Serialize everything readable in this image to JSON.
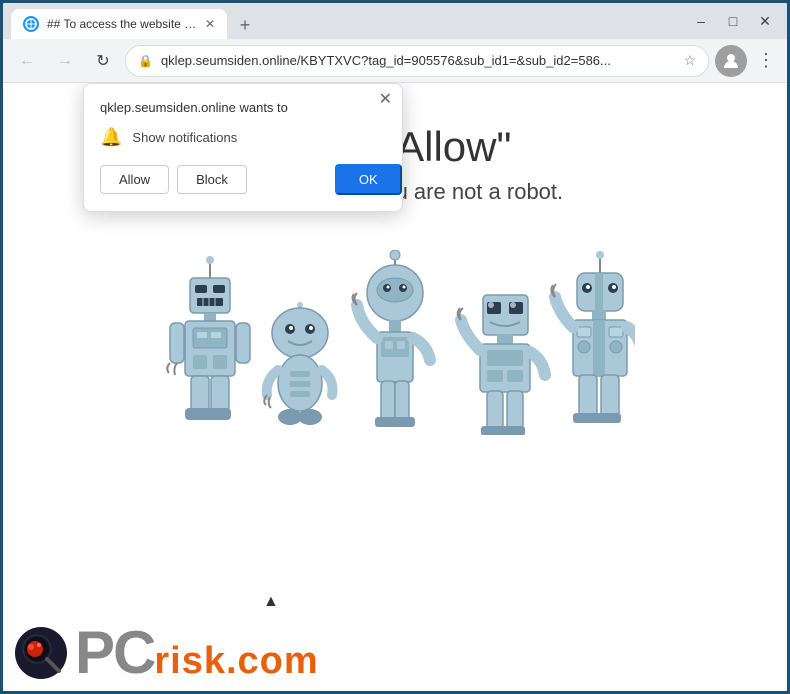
{
  "browser": {
    "tab": {
      "title": "## To access the website click th...",
      "favicon": "🌐"
    },
    "address": {
      "url": "qklep.seumsiden.online/KBYTXVC?tag_id=905576&sub_id1=&sub_id2=586...",
      "lock_icon": "🔒"
    },
    "new_tab_label": "+",
    "window_controls": {
      "minimize": "–",
      "maximize": "□",
      "close": "✕"
    },
    "nav": {
      "back": "‹",
      "forward": "›",
      "refresh": "↻"
    }
  },
  "notification_popup": {
    "title": "qklep.seumsiden.online wants to",
    "permission_text": "Show notifications",
    "allow_button": "Allow",
    "block_button": "Block",
    "ok_button": "OK",
    "close_icon": "✕"
  },
  "page": {
    "heading": "Click \"Allow\"",
    "subtext": "to confirm that you are not a robot."
  },
  "pcrisk": {
    "pc_text": "PC",
    "risk_text": "risk.com"
  }
}
